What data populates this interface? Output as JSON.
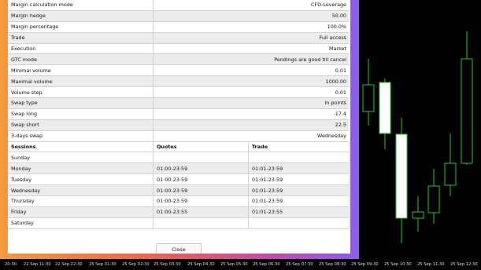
{
  "spec_rows": [
    {
      "label": "Margin calculation mode",
      "value": "CFD-Leverage"
    },
    {
      "label": "Margin hedge",
      "value": "50.00"
    },
    {
      "label": "Margin percentage",
      "value": "100.0%"
    },
    {
      "label": "Trade",
      "value": "Full access"
    },
    {
      "label": "Execution",
      "value": "Market"
    },
    {
      "label": "GTC mode",
      "value": "Pendings are good till cancel"
    },
    {
      "label": "Minimal volume",
      "value": "0.01"
    },
    {
      "label": "Maximal volume",
      "value": "1000.00"
    },
    {
      "label": "Volume step",
      "value": "0.01"
    },
    {
      "label": "Swap type",
      "value": "In points"
    },
    {
      "label": "Swap long",
      "value": "-17.4"
    },
    {
      "label": "Swap short",
      "value": "22.5"
    },
    {
      "label": "3-days swap",
      "value": "Wednesday"
    }
  ],
  "sessions": {
    "headers": [
      "Sessions",
      "Quotes",
      "Trade"
    ],
    "rows": [
      {
        "day": "Sunday",
        "quotes": "",
        "trade": ""
      },
      {
        "day": "Monday",
        "quotes": "01:00-23:59",
        "trade": "01:01-23:59"
      },
      {
        "day": "Tuesday",
        "quotes": "01:00-23:59",
        "trade": "01:01-23:59"
      },
      {
        "day": "Wednesday",
        "quotes": "01:00-23:59",
        "trade": "01:01-23:59"
      },
      {
        "day": "Thursday",
        "quotes": "01:00-23:59",
        "trade": "01:01-23:59"
      },
      {
        "day": "Friday",
        "quotes": "01:00-23:55",
        "trade": "01:01-23:55"
      },
      {
        "day": "Saturday",
        "quotes": "",
        "trade": ""
      }
    ]
  },
  "close_label": "Close",
  "time_labels": [
    "20:30",
    "22 Sep 11:30",
    "22 Sep 22:30",
    "25 Sep 01:30",
    "25 Sep 02:30",
    "25 Sep 03:30",
    "25 Sep 04:30",
    "25 Sep 05:30",
    "25 Sep 06:30",
    "25 Sep 07:30",
    "25 Sep 08:30",
    "25 Sep 09:30",
    "25 Sep 10:30",
    "25 Sep 11:30",
    "25 Sep 12:30"
  ],
  "colors": {
    "chart_bg": "#000000",
    "candle_line": "#2fbf2f",
    "bull_body": "#000000",
    "bear_body": "#ffffff"
  }
}
